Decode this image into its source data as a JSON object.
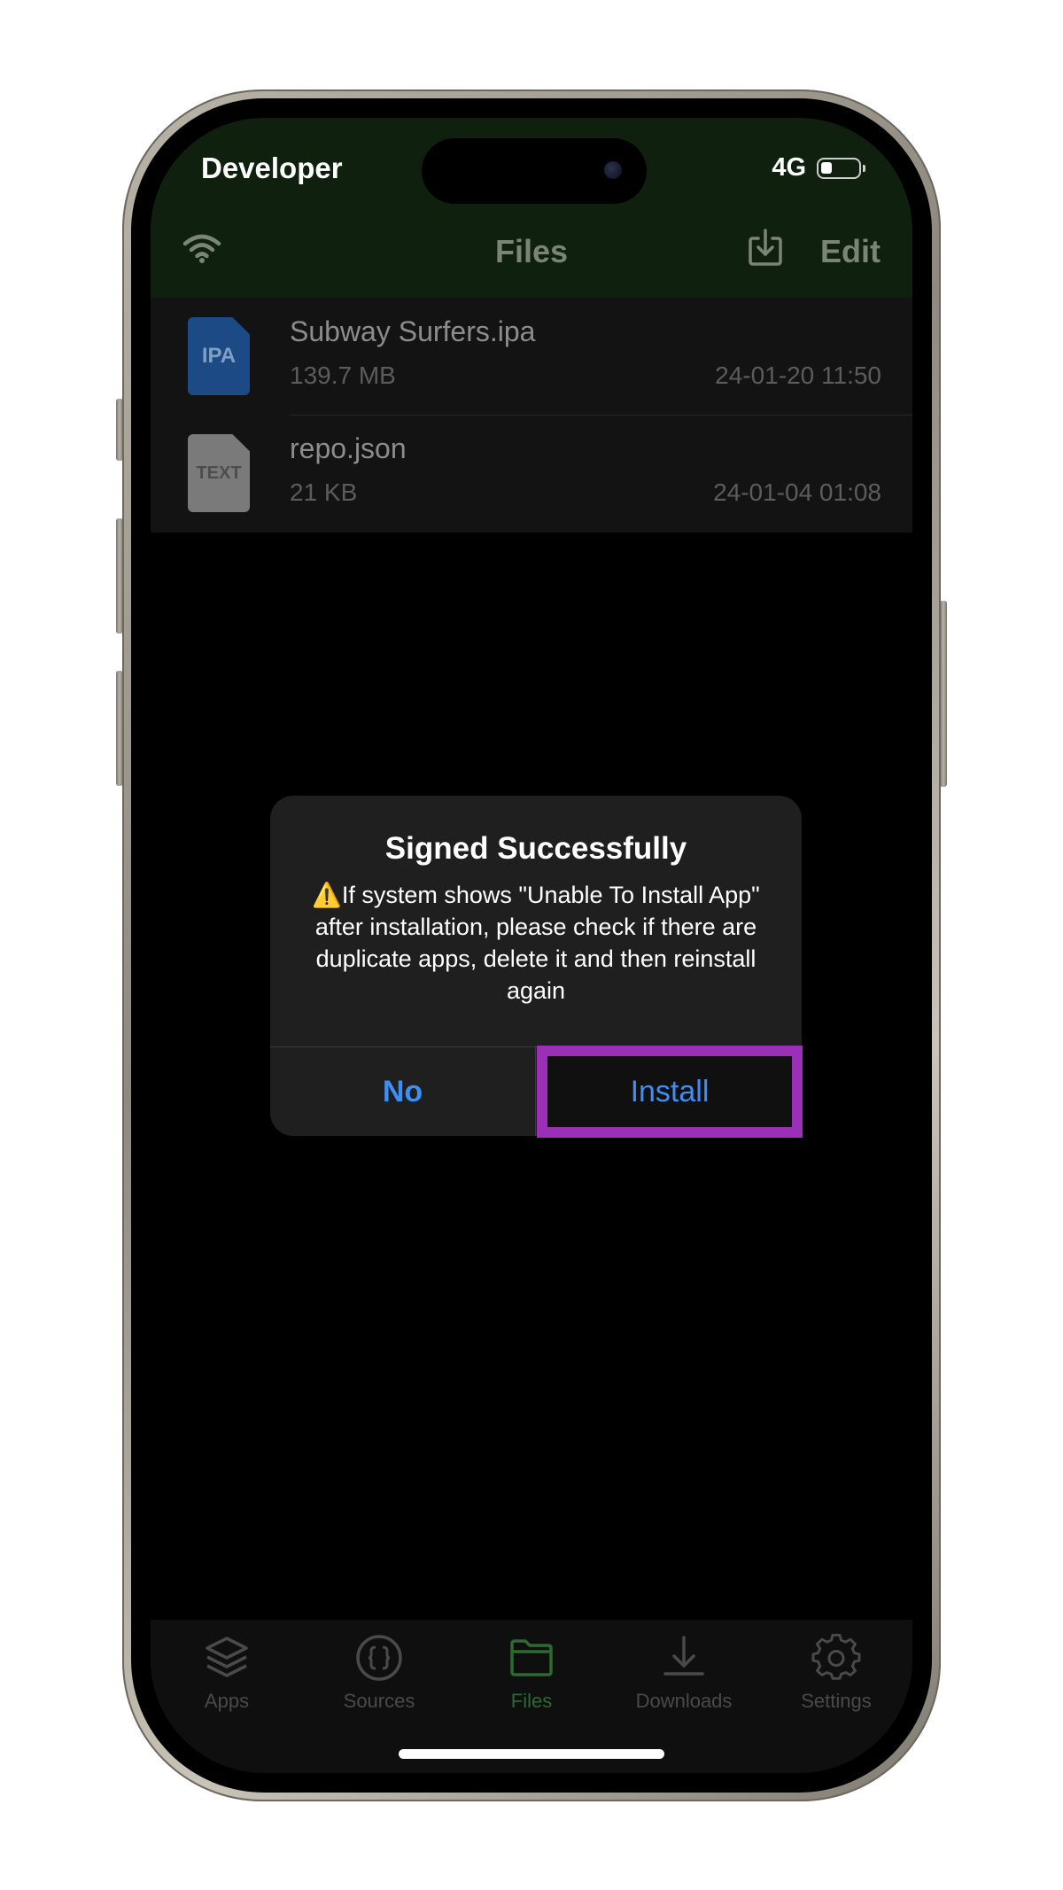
{
  "status_bar": {
    "carrier": "Developer",
    "network": "4G",
    "battery_level": 0.3
  },
  "nav_bar": {
    "title": "Files",
    "edit_label": "Edit",
    "wifi_icon": "wifi-icon",
    "import_icon": "download-tray-icon"
  },
  "files": [
    {
      "icon_label": "IPA",
      "name": "Subway Surfers.ipa",
      "size": "139.7 MB",
      "date": "24-01-20 11:50"
    },
    {
      "icon_label": "TEXT",
      "name": "repo.json",
      "size": "21 KB",
      "date": "24-01-04 01:08"
    }
  ],
  "alert": {
    "title": "Signed Successfully",
    "message": "⚠️If system shows \"Unable To Install App\" after installation, please check if there are duplicate apps, delete it and then reinstall again",
    "no_label": "No",
    "install_label": "Install"
  },
  "tabs": [
    {
      "label": "Apps",
      "icon": "layers-icon",
      "active": false
    },
    {
      "label": "Sources",
      "icon": "braces-icon",
      "active": false
    },
    {
      "label": "Files",
      "icon": "folder-icon",
      "active": true
    },
    {
      "label": "Downloads",
      "icon": "download-icon",
      "active": false
    },
    {
      "label": "Settings",
      "icon": "gear-icon",
      "active": false
    }
  ],
  "colors": {
    "accent": "#3d8ff5",
    "highlight": "#9b2fb7",
    "active_tab": "#2c6b2f",
    "nav_bg": "#10200f"
  }
}
